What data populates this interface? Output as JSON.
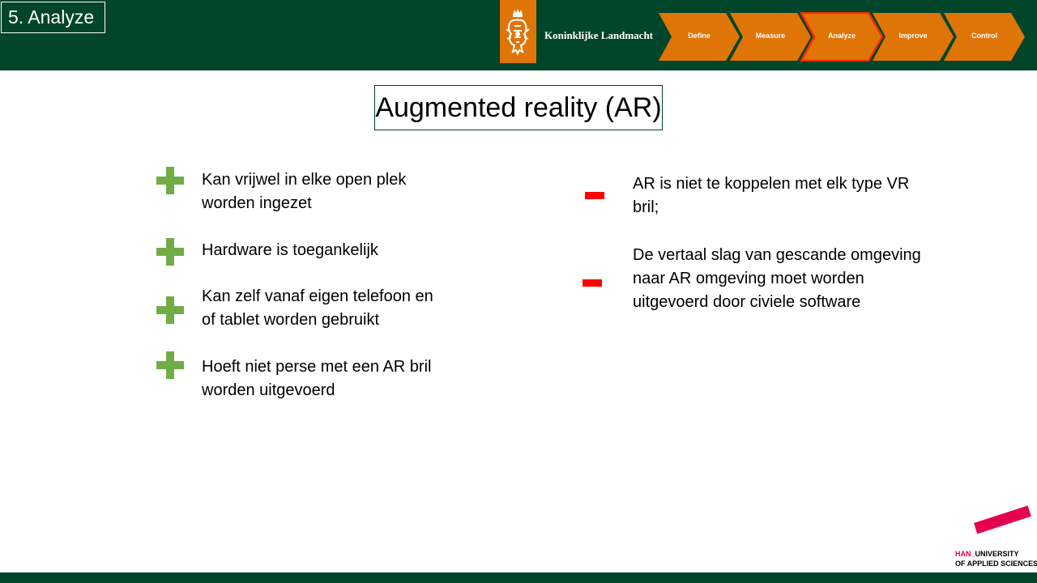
{
  "header": {
    "section_label": "5. Analyze",
    "org_name": "Koninklijke Landmacht",
    "steps": [
      {
        "label": "Define",
        "active": false
      },
      {
        "label": "Measure",
        "active": false
      },
      {
        "label": "Analyze",
        "active": true
      },
      {
        "label": "Improve",
        "active": false
      },
      {
        "label": "Control",
        "active": false
      }
    ]
  },
  "title": "Augmented reality (AR)",
  "pros": [
    {
      "line1": "Kan vrijwel in elke open plek",
      "line2": "worden ingezet"
    },
    {
      "line1": "Hardware is toegankelijk",
      "line2": ""
    },
    {
      "line1": "Kan zelf vanaf eigen telefoon en",
      "line2": "of tablet worden gebruikt"
    },
    {
      "line1": "Hoeft niet perse met een AR bril",
      "line2": "worden uitgevoerd"
    }
  ],
  "cons": [
    {
      "line1": "AR is niet te koppelen met elk type VR",
      "line2": "bril;",
      "line3": ""
    },
    {
      "line1": "De vertaal slag van gescande omgeving",
      "line2": "naar AR omgeving moet worden",
      "line3": "uitgevoerd door civiele software"
    }
  ],
  "footer": {
    "brand": "HAN_",
    "line1": "UNIVERSITY",
    "line2": "OF APPLIED SCIENCES"
  },
  "colors": {
    "dark_green": "#01452a",
    "orange": "#e07507",
    "active_step_border": "#ff2a00",
    "pro_green": "#70ad47",
    "con_red": "#ff0000",
    "han_pink": "#e5004d"
  },
  "icons": {
    "pro": "plus-icon",
    "con": "minus-icon",
    "crest": "lion-crest-icon"
  }
}
